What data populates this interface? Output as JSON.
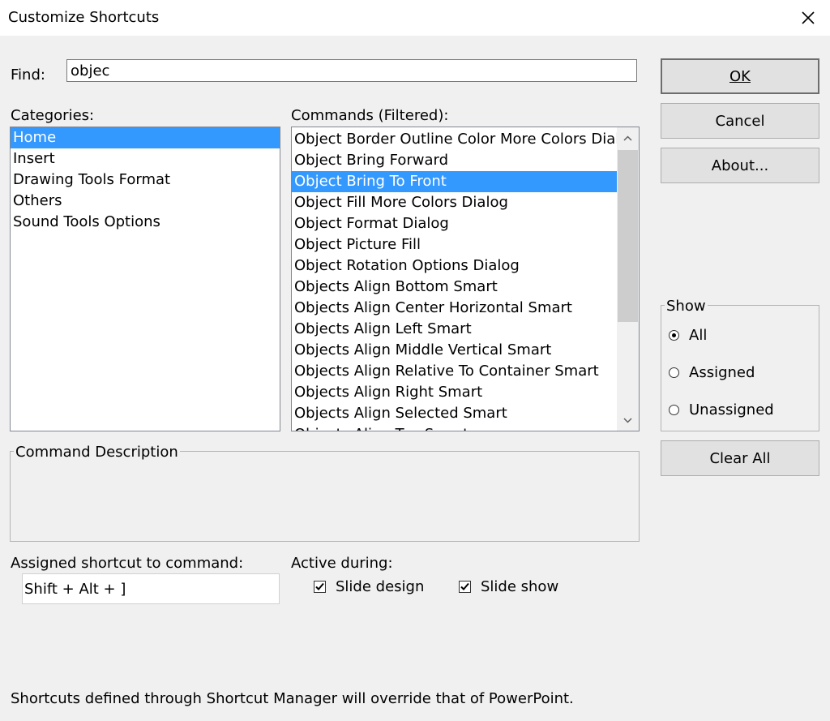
{
  "window": {
    "title": "Customize Shortcuts",
    "close_icon": "close-icon"
  },
  "find": {
    "label": "Find:",
    "value": "objec"
  },
  "categories": {
    "label": "Categories:",
    "items": [
      {
        "label": "Home",
        "selected": true
      },
      {
        "label": "Insert",
        "selected": false
      },
      {
        "label": "Drawing Tools Format",
        "selected": false
      },
      {
        "label": "Others",
        "selected": false
      },
      {
        "label": "Sound Tools Options",
        "selected": false
      }
    ]
  },
  "commands": {
    "label": "Commands (Filtered):",
    "items": [
      {
        "label": "Object Border Outline Color More Colors Dialog",
        "selected": false
      },
      {
        "label": "Object Bring Forward",
        "selected": false
      },
      {
        "label": "Object Bring To Front",
        "selected": true
      },
      {
        "label": "Object Fill More Colors Dialog",
        "selected": false
      },
      {
        "label": "Object Format Dialog",
        "selected": false
      },
      {
        "label": "Object Picture Fill",
        "selected": false
      },
      {
        "label": "Object Rotation Options Dialog",
        "selected": false
      },
      {
        "label": "Objects Align Bottom Smart",
        "selected": false
      },
      {
        "label": "Objects Align Center Horizontal Smart",
        "selected": false
      },
      {
        "label": "Objects Align Left Smart",
        "selected": false
      },
      {
        "label": "Objects Align Middle Vertical Smart",
        "selected": false
      },
      {
        "label": "Objects Align Relative To Container Smart",
        "selected": false
      },
      {
        "label": "Objects Align Right Smart",
        "selected": false
      },
      {
        "label": "Objects Align Selected Smart",
        "selected": false
      },
      {
        "label": "Objects Align Top Smart",
        "selected": false
      }
    ]
  },
  "buttons": {
    "ok": "OK",
    "cancel": "Cancel",
    "about": "About...",
    "clear_all": "Clear All"
  },
  "show": {
    "label": "Show",
    "options": [
      {
        "label": "All",
        "checked": true
      },
      {
        "label": "Assigned",
        "checked": false
      },
      {
        "label": "Unassigned",
        "checked": false
      }
    ]
  },
  "description": {
    "label": "Command Description",
    "text": ""
  },
  "assigned": {
    "label": "Assigned shortcut to command:",
    "value": "Shift + Alt + ]"
  },
  "active_during": {
    "label": "Active during:",
    "slide_design": {
      "label": "Slide design",
      "checked": true
    },
    "slide_show": {
      "label": "Slide show",
      "checked": true
    }
  },
  "footer": {
    "note": "Shortcuts defined through Shortcut Manager will override that of PowerPoint."
  },
  "colors": {
    "selection": "#3399ff",
    "dialog_bg": "#f0f0f0"
  }
}
